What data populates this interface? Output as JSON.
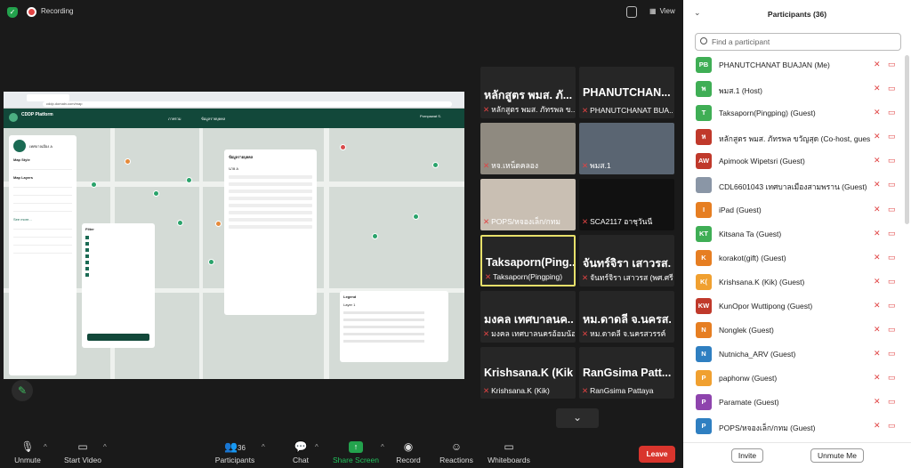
{
  "top_bar": {
    "recording_label": "Recording",
    "view_label": "View"
  },
  "shared_screen": {
    "url": "cddp.domain.com/map",
    "app_name": "CDDP Platform",
    "nav_1": "ภาพรวม",
    "nav_2": "ข้อมูลรายบุคคล",
    "user_label": "Pornpawat S.",
    "panel_user": "เทศบาลเมือง A",
    "map_style": "Map Style",
    "map_layers": "Map Layers",
    "see_more": "See more...",
    "filter_title": "Filter",
    "detail_title": "ข้อมูลรายบุคคล",
    "detail_name": "นาย A",
    "legend_title": "Legend",
    "legend_layer": "Layer 1"
  },
  "video_grid": {
    "tiles": [
      {
        "big": "หลักสูตร พมส. ภั...",
        "label": "หลักสูตร พมส. ภัทรพล ข..."
      },
      {
        "big": "PHANUTCHAN...",
        "label": "PHANUTCHANAT BUA..."
      },
      {
        "big": "",
        "label": "หจ.เหน็ดคลอง"
      },
      {
        "big": "",
        "label": "พมส.1"
      },
      {
        "big": "",
        "label": "POPS/หจองเล็ก/กทม"
      },
      {
        "big": "",
        "label": "SCA2117 อาชุวันนี"
      },
      {
        "big": "Taksaporn(Ping...",
        "label": "Taksaporn(Pingping)"
      },
      {
        "big": "จันทร์จิรา เสาวรส...",
        "label": "จันทร์จิรา เสาวรส (พศ.ศรีล..."
      },
      {
        "big": "มงคล เทศบาลนค...",
        "label": "มงคล เทศบาลนครอ้อมน้อย"
      },
      {
        "big": "หม.ดาดลี จ.นครส...",
        "label": "หม.ดาดลี จ.นครสวรรค์"
      },
      {
        "big": "Krishsana.K (Kik)",
        "label": "Krishsana.K (Kik)"
      },
      {
        "big": "RanGsima  Patt...",
        "label": "RanGsima  Pattaya"
      }
    ]
  },
  "toolbar": {
    "unmute": "Unmute",
    "start_video": "Start Video",
    "participants": "Participants",
    "participants_count": "36",
    "chat": "Chat",
    "share_screen": "Share Screen",
    "record": "Record",
    "reactions": "Reactions",
    "whiteboards": "Whiteboards",
    "leave": "Leave"
  },
  "participants_panel": {
    "title": "Participants (36)",
    "search_placeholder": "Find a participant",
    "invite": "Invite",
    "unmute_me": "Unmute Me",
    "rows": [
      {
        "initials": "PB",
        "color": "#3fae55",
        "name": "PHANUTCHANAT BUAJAN (Me)"
      },
      {
        "initials": "พ",
        "color": "#3fae55",
        "name": "พมส.1 (Host)"
      },
      {
        "initials": "T",
        "color": "#3fae55",
        "name": "Taksaporn(Pingping) (Guest)"
      },
      {
        "initials": "ห",
        "color": "#c0392b",
        "name": "หลักสูตร พมส. ภัทรพล ขวัญสุด (Co-host, guest)"
      },
      {
        "initials": "AW",
        "color": "#c0392b",
        "name": "Apimook Wipetsri (Guest)"
      },
      {
        "initials": "",
        "color": "#8a96a6",
        "name": "CDL6601043 เทศบาลเมืองสามพราน (Guest)"
      },
      {
        "initials": "I",
        "color": "#e67e22",
        "name": "iPad (Guest)"
      },
      {
        "initials": "KT",
        "color": "#3fae55",
        "name": "Kitsana Ta (Guest)"
      },
      {
        "initials": "K",
        "color": "#e67e22",
        "name": "korakot(gift) (Guest)"
      },
      {
        "initials": "K(",
        "color": "#f0a030",
        "name": "Krishsana.K (Kik) (Guest)"
      },
      {
        "initials": "KW",
        "color": "#c0392b",
        "name": "KunOpor Wuttipong (Guest)"
      },
      {
        "initials": "N",
        "color": "#e67e22",
        "name": "Nonglek (Guest)"
      },
      {
        "initials": "N",
        "color": "#2f7fc1",
        "name": "Nutnicha_ARV (Guest)"
      },
      {
        "initials": "P",
        "color": "#f0a030",
        "name": "paphonw (Guest)"
      },
      {
        "initials": "P",
        "color": "#8e44ad",
        "name": "Paramate (Guest)"
      },
      {
        "initials": "P",
        "color": "#2f7fc1",
        "name": "POPS/หจองเล็ก/กทม (Guest)"
      }
    ]
  }
}
